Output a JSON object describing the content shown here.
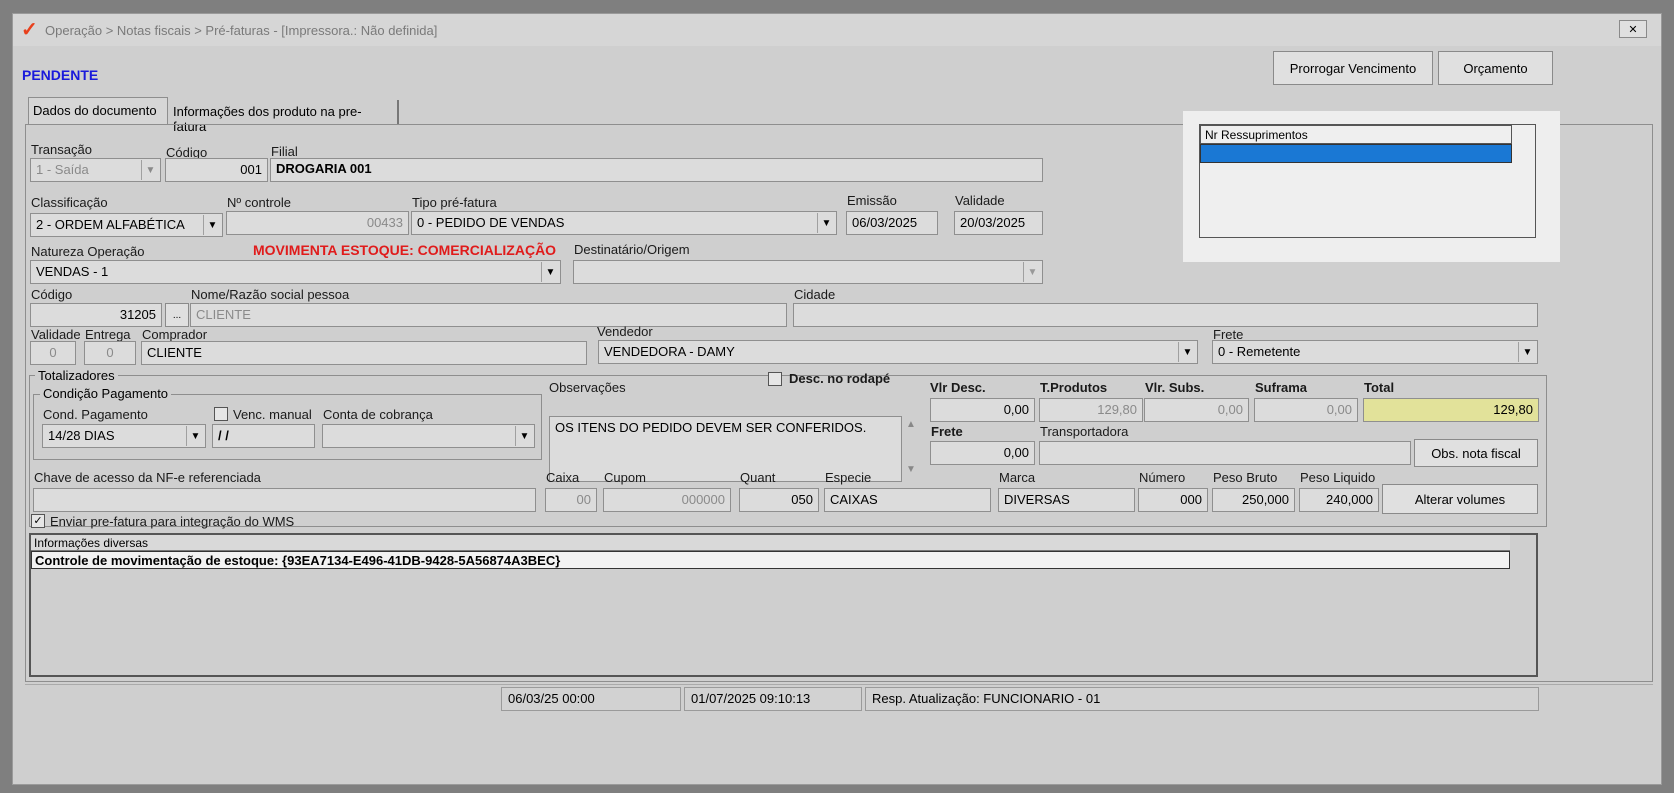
{
  "window": {
    "title": "Operação > Notas fiscais > Pré-faturas - [Impressora.: Não definida]",
    "close": "✕"
  },
  "status": "PENDENTE",
  "buttons": {
    "prorrogar": "Prorrogar Vencimento",
    "orcamento": "Orçamento",
    "obs_nota": "Obs. nota fiscal",
    "alterar_volumes": "Alterar volumes"
  },
  "tabs": [
    "Dados do documento",
    "Informações dos produto na pre-fatura"
  ],
  "fields": {
    "transacao_label": "Transação",
    "transacao": "1 - Saída",
    "codigo_label": "Código",
    "codigo": "001",
    "filial_label": "Filial",
    "filial": "DROGARIA 001",
    "classificacao_label": "Classificação",
    "classificacao": "2 - ORDEM ALFABÉTICA",
    "nr_controle_label": "Nº controle",
    "nr_controle": "00433",
    "tipo_prefatura_label": "Tipo pré-fatura",
    "tipo_prefatura": "0 - PEDIDO DE VENDAS",
    "emissao_label": "Emissão",
    "emissao": "06/03/2025",
    "validade_label": "Validade",
    "validade": "20/03/2025",
    "natureza_label": "Natureza  Operação",
    "natureza": "VENDAS - 1",
    "movimenta": "MOVIMENTA ESTOQUE: COMERCIALIZAÇÃO",
    "destinatario_label": "Destinatário/Origem",
    "destinatario": "",
    "pessoa_codigo_label": "Código",
    "pessoa_codigo": "31205",
    "ellipsis": "...",
    "nome_label": "Nome/Razão social pessoa",
    "nome": "CLIENTE",
    "cidade_label": "Cidade",
    "cidade": "",
    "validade_dias_label": "Validade",
    "validade_dias": "0",
    "entrega_label": "Entrega",
    "entrega": "0",
    "comprador_label": "Comprador",
    "comprador": "CLIENTE",
    "vendedor_label": "Vendedor",
    "vendedor": "VENDEDORA - DAMY",
    "frete_tipo_label": "Frete",
    "frete_tipo": "0 - Remetente"
  },
  "resupply": {
    "header": "Nr Ressuprimentos",
    "rows": [
      ""
    ]
  },
  "totalizadores": {
    "title": "Totalizadores",
    "cond_group": "Condição Pagamento",
    "cond_label": "Cond. Pagamento",
    "cond": "14/28 DIAS",
    "venc_manual_label": "Venc. manual",
    "venc_manual": "/ /",
    "conta_label": "Conta de cobrança",
    "conta": "",
    "obs_label": "Observações",
    "obs": "OS ITENS DO PEDIDO DEVEM SER CONFERIDOS.",
    "desc_rodape_label": "Desc. no rodapé",
    "vlr_desc_label": "Vlr Desc.",
    "vlr_desc": "0,00",
    "tprodutos_label": "T.Produtos",
    "tprodutos": "129,80",
    "vlr_subs_label": "Vlr. Subs.",
    "vlr_subs": "0,00",
    "suframa_label": "Suframa",
    "suframa": "0,00",
    "total_label": "Total",
    "total": "129,80",
    "frete_label": "Frete",
    "frete": "0,00",
    "transportadora_label": "Transportadora",
    "transportadora": "",
    "chave_label": "Chave de acesso da NF-e referenciada",
    "chave": "",
    "caixa_label": "Caixa",
    "caixa": "00",
    "cupom_label": "Cupom",
    "cupom": "000000",
    "quant_label": "Quant",
    "quant": "050",
    "especie_label": "Especie",
    "especie": "CAIXAS",
    "marca_label": "Marca",
    "marca": "DIVERSAS",
    "numero_label": "Número",
    "numero": "000",
    "peso_bruto_label": "Peso Bruto",
    "peso_bruto": "250,000",
    "peso_liquido_label": "Peso Liquido",
    "peso_liquido": "240,000"
  },
  "wms_label": "Enviar pre-fatura para integração do WMS",
  "info": {
    "header": "Informações diversas",
    "line": "Controle de movimentação de estoque: {93EA7134-E496-41DB-9428-5A56874A3BEC}"
  },
  "statusbar": {
    "s1": "06/03/25 00:00",
    "s2": "01/07/2025 09:10:13",
    "s3": "Resp. Atualização: FUNCIONARIO - 01"
  },
  "colors": {
    "accent_blue": "#1a1adb",
    "warning_red": "#e01b1b",
    "total_bg": "#e2e29a",
    "selection": "#1a78d4"
  }
}
